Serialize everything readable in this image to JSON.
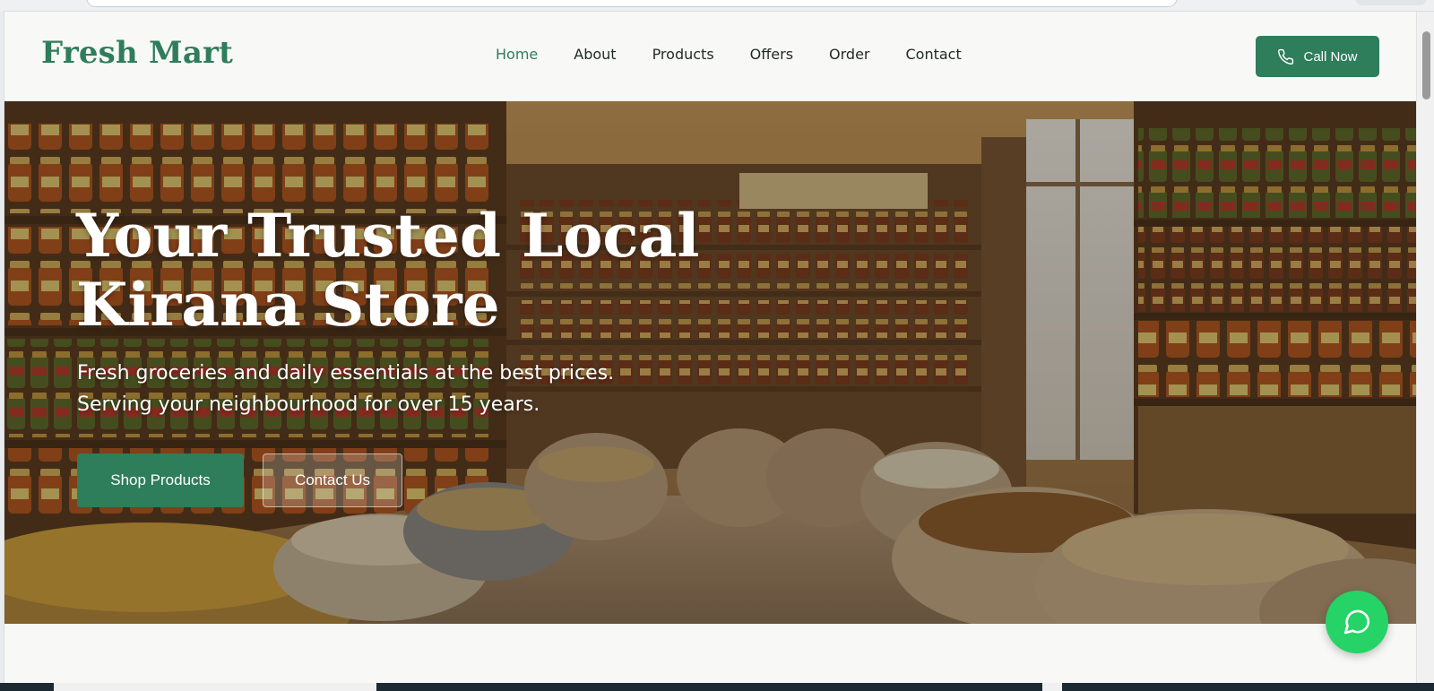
{
  "header": {
    "logo": "Fresh Mart",
    "nav": [
      {
        "label": "Home",
        "active": true
      },
      {
        "label": "About",
        "active": false
      },
      {
        "label": "Products",
        "active": false
      },
      {
        "label": "Offers",
        "active": false
      },
      {
        "label": "Order",
        "active": false
      },
      {
        "label": "Contact",
        "active": false
      }
    ],
    "call_button": "Call Now"
  },
  "hero": {
    "title": "Your Trusted Local Kirana Store",
    "subtitle_line1": "Fresh groceries and daily essentials at the best prices.",
    "subtitle_line2": "Serving your neighbourhood for over 15 years.",
    "primary_button": "Shop Products",
    "secondary_button": "Contact Us"
  },
  "colors": {
    "brand_green": "#2e7d5b",
    "whatsapp_green": "#25d366",
    "page_background": "#f8f8f6"
  },
  "icons": {
    "call_button": "phone-icon",
    "fab": "whatsapp-chat-icon"
  }
}
